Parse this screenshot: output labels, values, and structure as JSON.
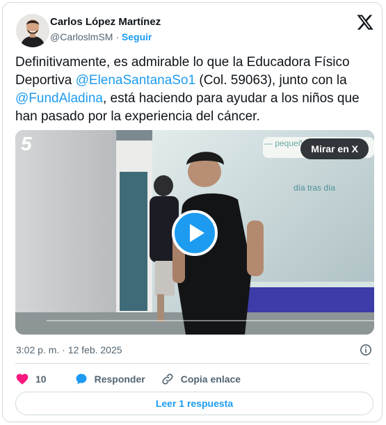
{
  "author": {
    "name": "Carlos López Martínez",
    "handle": "@CarloslmSM",
    "separator": "·",
    "follow_label": "Seguir"
  },
  "tweet": {
    "text_1": "Definitivamente, es admirable lo que la Educadora Físico Deportiva ",
    "mention_1": "@ElenaSantanaSo1",
    "text_2": " (Col. 59063), junto con la ",
    "mention_2": "@FundAladina",
    "text_3": ", está haciendo para ayudar a los niños que han pasado por la experiencia del cáncer."
  },
  "video": {
    "channel_logo": "5",
    "watch_label": "Mirar en X",
    "wall_sign_1": "— pequeñ",
    "wall_sign_2": "día tras día"
  },
  "meta": {
    "timestamp": "3:02 p. m. · 12 feb. 2025"
  },
  "actions": {
    "like_count": "10",
    "reply_label": "Responder",
    "copy_label": "Copia enlace"
  },
  "read_replies_label": "Leer 1 respuesta",
  "colors": {
    "accent": "#1d9bf0",
    "like": "#f91880",
    "text": "#0f1419",
    "muted": "#536471",
    "border": "#cfd9de"
  },
  "icons": [
    "x-logo-icon",
    "play-icon",
    "info-icon",
    "heart-icon",
    "reply-bubble-icon",
    "link-icon"
  ]
}
